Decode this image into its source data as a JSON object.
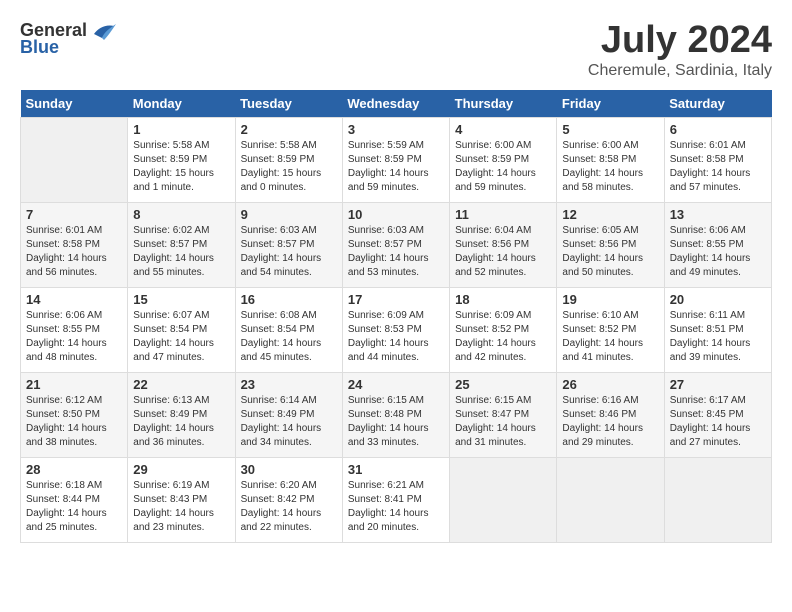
{
  "logo": {
    "general": "General",
    "blue": "Blue"
  },
  "title": {
    "month_year": "July 2024",
    "location": "Cheremule, Sardinia, Italy"
  },
  "days_of_week": [
    "Sunday",
    "Monday",
    "Tuesday",
    "Wednesday",
    "Thursday",
    "Friday",
    "Saturday"
  ],
  "weeks": [
    [
      {
        "day": "",
        "info": ""
      },
      {
        "day": "1",
        "info": "Sunrise: 5:58 AM\nSunset: 8:59 PM\nDaylight: 15 hours\nand 1 minute."
      },
      {
        "day": "2",
        "info": "Sunrise: 5:58 AM\nSunset: 8:59 PM\nDaylight: 15 hours\nand 0 minutes."
      },
      {
        "day": "3",
        "info": "Sunrise: 5:59 AM\nSunset: 8:59 PM\nDaylight: 14 hours\nand 59 minutes."
      },
      {
        "day": "4",
        "info": "Sunrise: 6:00 AM\nSunset: 8:59 PM\nDaylight: 14 hours\nand 59 minutes."
      },
      {
        "day": "5",
        "info": "Sunrise: 6:00 AM\nSunset: 8:58 PM\nDaylight: 14 hours\nand 58 minutes."
      },
      {
        "day": "6",
        "info": "Sunrise: 6:01 AM\nSunset: 8:58 PM\nDaylight: 14 hours\nand 57 minutes."
      }
    ],
    [
      {
        "day": "7",
        "info": "Sunrise: 6:01 AM\nSunset: 8:58 PM\nDaylight: 14 hours\nand 56 minutes."
      },
      {
        "day": "8",
        "info": "Sunrise: 6:02 AM\nSunset: 8:57 PM\nDaylight: 14 hours\nand 55 minutes."
      },
      {
        "day": "9",
        "info": "Sunrise: 6:03 AM\nSunset: 8:57 PM\nDaylight: 14 hours\nand 54 minutes."
      },
      {
        "day": "10",
        "info": "Sunrise: 6:03 AM\nSunset: 8:57 PM\nDaylight: 14 hours\nand 53 minutes."
      },
      {
        "day": "11",
        "info": "Sunrise: 6:04 AM\nSunset: 8:56 PM\nDaylight: 14 hours\nand 52 minutes."
      },
      {
        "day": "12",
        "info": "Sunrise: 6:05 AM\nSunset: 8:56 PM\nDaylight: 14 hours\nand 50 minutes."
      },
      {
        "day": "13",
        "info": "Sunrise: 6:06 AM\nSunset: 8:55 PM\nDaylight: 14 hours\nand 49 minutes."
      }
    ],
    [
      {
        "day": "14",
        "info": "Sunrise: 6:06 AM\nSunset: 8:55 PM\nDaylight: 14 hours\nand 48 minutes."
      },
      {
        "day": "15",
        "info": "Sunrise: 6:07 AM\nSunset: 8:54 PM\nDaylight: 14 hours\nand 47 minutes."
      },
      {
        "day": "16",
        "info": "Sunrise: 6:08 AM\nSunset: 8:54 PM\nDaylight: 14 hours\nand 45 minutes."
      },
      {
        "day": "17",
        "info": "Sunrise: 6:09 AM\nSunset: 8:53 PM\nDaylight: 14 hours\nand 44 minutes."
      },
      {
        "day": "18",
        "info": "Sunrise: 6:09 AM\nSunset: 8:52 PM\nDaylight: 14 hours\nand 42 minutes."
      },
      {
        "day": "19",
        "info": "Sunrise: 6:10 AM\nSunset: 8:52 PM\nDaylight: 14 hours\nand 41 minutes."
      },
      {
        "day": "20",
        "info": "Sunrise: 6:11 AM\nSunset: 8:51 PM\nDaylight: 14 hours\nand 39 minutes."
      }
    ],
    [
      {
        "day": "21",
        "info": "Sunrise: 6:12 AM\nSunset: 8:50 PM\nDaylight: 14 hours\nand 38 minutes."
      },
      {
        "day": "22",
        "info": "Sunrise: 6:13 AM\nSunset: 8:49 PM\nDaylight: 14 hours\nand 36 minutes."
      },
      {
        "day": "23",
        "info": "Sunrise: 6:14 AM\nSunset: 8:49 PM\nDaylight: 14 hours\nand 34 minutes."
      },
      {
        "day": "24",
        "info": "Sunrise: 6:15 AM\nSunset: 8:48 PM\nDaylight: 14 hours\nand 33 minutes."
      },
      {
        "day": "25",
        "info": "Sunrise: 6:15 AM\nSunset: 8:47 PM\nDaylight: 14 hours\nand 31 minutes."
      },
      {
        "day": "26",
        "info": "Sunrise: 6:16 AM\nSunset: 8:46 PM\nDaylight: 14 hours\nand 29 minutes."
      },
      {
        "day": "27",
        "info": "Sunrise: 6:17 AM\nSunset: 8:45 PM\nDaylight: 14 hours\nand 27 minutes."
      }
    ],
    [
      {
        "day": "28",
        "info": "Sunrise: 6:18 AM\nSunset: 8:44 PM\nDaylight: 14 hours\nand 25 minutes."
      },
      {
        "day": "29",
        "info": "Sunrise: 6:19 AM\nSunset: 8:43 PM\nDaylight: 14 hours\nand 23 minutes."
      },
      {
        "day": "30",
        "info": "Sunrise: 6:20 AM\nSunset: 8:42 PM\nDaylight: 14 hours\nand 22 minutes."
      },
      {
        "day": "31",
        "info": "Sunrise: 6:21 AM\nSunset: 8:41 PM\nDaylight: 14 hours\nand 20 minutes."
      },
      {
        "day": "",
        "info": ""
      },
      {
        "day": "",
        "info": ""
      },
      {
        "day": "",
        "info": ""
      }
    ]
  ]
}
